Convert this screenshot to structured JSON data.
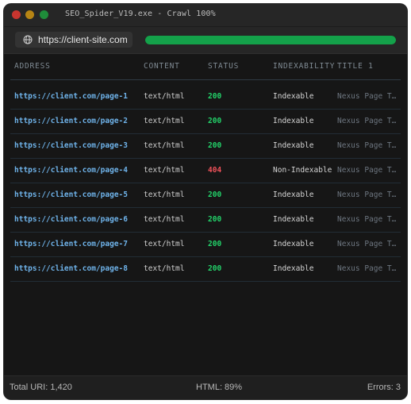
{
  "window": {
    "title": "SEO_Spider_V19.exe - Crawl 100%"
  },
  "toolbar": {
    "url": "https://client-site.com",
    "progress_percent": 100
  },
  "table": {
    "headers": [
      "ADDRESS",
      "CONTENT",
      "STATUS",
      "INDEXABILITY",
      "TITLE 1"
    ],
    "rows": [
      {
        "address": "https://client.com/page-1",
        "content": "text/html",
        "status": "200",
        "indexability": "Indexable",
        "title": "Nexus Page T…"
      },
      {
        "address": "https://client.com/page-2",
        "content": "text/html",
        "status": "200",
        "indexability": "Indexable",
        "title": "Nexus Page T…"
      },
      {
        "address": "https://client.com/page-3",
        "content": "text/html",
        "status": "200",
        "indexability": "Indexable",
        "title": "Nexus Page T…"
      },
      {
        "address": "https://client.com/page-4",
        "content": "text/html",
        "status": "404",
        "indexability": "Non-Indexable",
        "title": "Nexus Page T…"
      },
      {
        "address": "https://client.com/page-5",
        "content": "text/html",
        "status": "200",
        "indexability": "Indexable",
        "title": "Nexus Page T…"
      },
      {
        "address": "https://client.com/page-6",
        "content": "text/html",
        "status": "200",
        "indexability": "Indexable",
        "title": "Nexus Page T…"
      },
      {
        "address": "https://client.com/page-7",
        "content": "text/html",
        "status": "200",
        "indexability": "Indexable",
        "title": "Nexus Page T…"
      },
      {
        "address": "https://client.com/page-8",
        "content": "text/html",
        "status": "200",
        "indexability": "Indexable",
        "title": "Nexus Page T…"
      }
    ]
  },
  "statusbar": {
    "total": "Total URI: 1,420",
    "html": "HTML: 89%",
    "errors": "Errors: 3"
  },
  "colors": {
    "status_ok": "#23d36a",
    "status_error": "#f0525a",
    "progress": "#14a14a",
    "link": "#6fb3ea"
  },
  "icons": {
    "url": "globe-icon"
  }
}
